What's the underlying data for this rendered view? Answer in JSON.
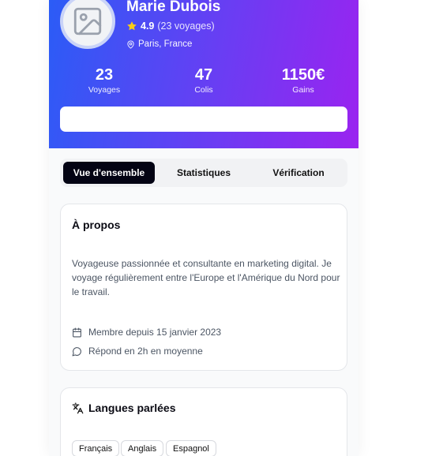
{
  "profile": {
    "name": "Marie Dubois",
    "rating": "4.9",
    "reviews": "(23 voyages)",
    "location": "Paris, France"
  },
  "stats": [
    {
      "value": "23",
      "label": "Voyages"
    },
    {
      "value": "47",
      "label": "Colis"
    },
    {
      "value": "1150€",
      "label": "Gains"
    }
  ],
  "tabs": [
    {
      "label": "Vue d'ensemble",
      "active": true
    },
    {
      "label": "Statistiques",
      "active": false
    },
    {
      "label": "Vérification",
      "active": false
    }
  ],
  "about": {
    "title": "À propos",
    "description": "Voyageuse passionnée et consultante en marketing digital. Je voyage régulièrement entre l'Europe et l'Amérique du Nord pour le travail.",
    "member_since": "Membre depuis 15 janvier 2023",
    "response": "Répond en 2h en moyenne"
  },
  "languages": {
    "title": "Langues parlées",
    "items": [
      "Français",
      "Anglais",
      "Espagnol"
    ]
  },
  "colors": {
    "gradient_start": "#2b5cf6",
    "gradient_end": "#9b23f0",
    "star": "#facc15",
    "active_tab": "#030313"
  }
}
